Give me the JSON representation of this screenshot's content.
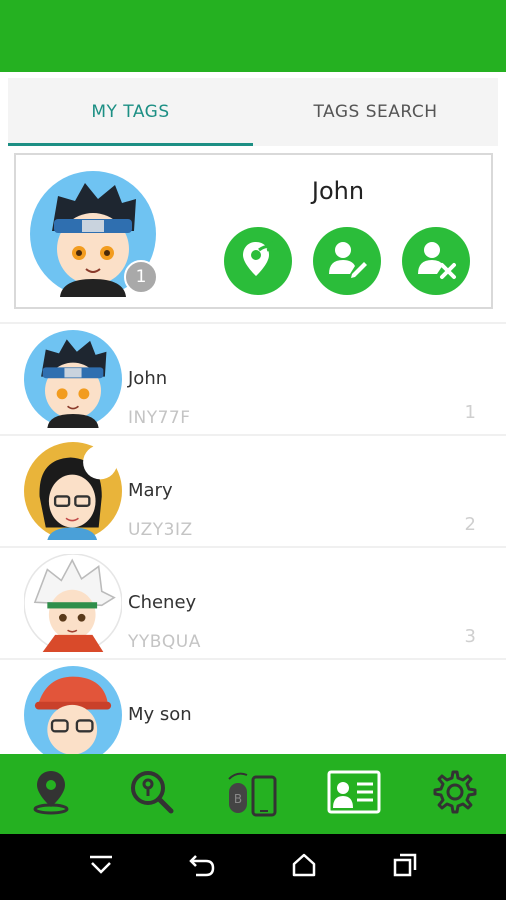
{
  "tabs": [
    {
      "label": "MY TAGS",
      "active": true
    },
    {
      "label": "TAGS SEARCH",
      "active": false
    }
  ],
  "selected_tag": {
    "name": "John",
    "badge": "1",
    "actions": [
      {
        "icon": "location-share-icon"
      },
      {
        "icon": "edit-user-icon"
      },
      {
        "icon": "remove-user-icon"
      }
    ]
  },
  "tags": [
    {
      "name": "John",
      "code": "INY77F",
      "number": "1",
      "avatar": "avatar-john"
    },
    {
      "name": "Mary",
      "code": "UZY3IZ",
      "number": "2",
      "avatar": "avatar-mary"
    },
    {
      "name": "Cheney",
      "code": "YYBQUA",
      "number": "3",
      "avatar": "avatar-cheney"
    },
    {
      "name": "My son",
      "code": "",
      "number": "",
      "avatar": "avatar-myson"
    }
  ],
  "bottom_nav": [
    {
      "icon": "map-pin-icon"
    },
    {
      "icon": "search-tag-icon"
    },
    {
      "icon": "bluetooth-phone-icon"
    },
    {
      "icon": "id-card-icon"
    },
    {
      "icon": "settings-gear-icon"
    }
  ],
  "system_nav": [
    {
      "icon": "hide-keyboard-icon"
    },
    {
      "icon": "back-icon"
    },
    {
      "icon": "home-icon"
    },
    {
      "icon": "recents-icon"
    }
  ],
  "colors": {
    "primary_green": "#25b121",
    "action_green": "#2bbd3a",
    "tab_active": "#1c8f84"
  }
}
